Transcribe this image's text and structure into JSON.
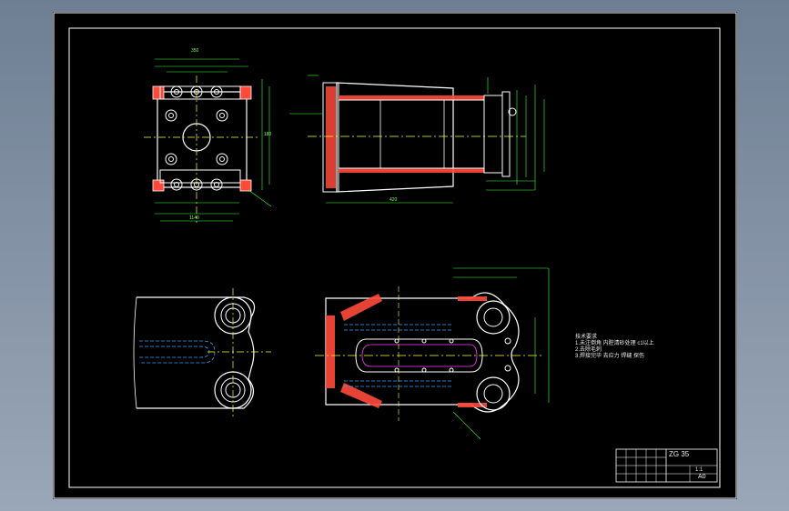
{
  "colors": {
    "background": "#000000",
    "border": "#ffffff",
    "outline": "#ffffff",
    "dimension": "#39ff39",
    "hatch": "#ff4a3a",
    "centerline": "#ffff33",
    "hidden": "#3aa0ff",
    "detail": "#ff3aff"
  },
  "notes": {
    "heading": "技术要求",
    "line1": "1.未注倒角  内腔清砂处理 c1以上",
    "line2": "2.去除毛刺",
    "line3": "3.焊接完毕 去应力 焊缝 探伤"
  },
  "title_block": {
    "material": "ZG 35",
    "scale_label": "1:1",
    "sheet_size": "A0"
  },
  "dimensions": {
    "top_left_width": "350",
    "top_left_height": "180",
    "side_length": "420",
    "bottom_length": "1140"
  }
}
